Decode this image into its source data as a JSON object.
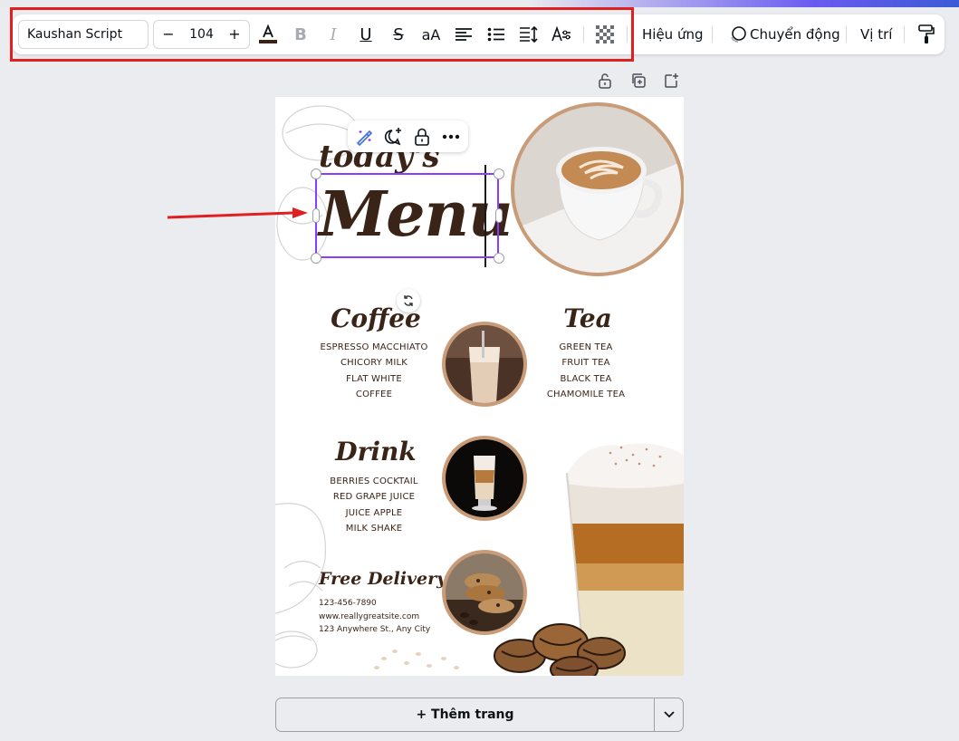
{
  "toolbar": {
    "font_family": "Kaushan Script",
    "font_size": "104",
    "minus_symbol": "−",
    "plus_symbol": "+",
    "case_label": "aA",
    "effects_label": "Hiệu ứng",
    "animate_label": "Chuyển động",
    "position_label": "Vị trí"
  },
  "floating_toolbar": {
    "icons": [
      "magic-edit-icon",
      "comment-add-icon",
      "lock-icon",
      "more-icon"
    ]
  },
  "design": {
    "heading_small": "today's",
    "heading_main": "Menu",
    "coffee": {
      "title": "Coffee",
      "items": [
        "ESPRESSO MACCHIATO",
        "CHICORY MILK",
        "FLAT WHITE",
        "COFFEE"
      ]
    },
    "tea": {
      "title": "Tea",
      "items": [
        "GREEN TEA",
        "FRUIT TEA",
        "BLACK TEA",
        "CHAMOMILE TEA"
      ]
    },
    "drink": {
      "title": "Drink",
      "items": [
        "BERRIES COCKTAIL",
        "RED GRAPE JUICE",
        "JUICE APPLE",
        "MILK SHAKE"
      ]
    },
    "delivery": {
      "title": "Free Delivery",
      "phone": "123-456-7890",
      "website": "www.reallygreatsite.com",
      "address": "123 Anywhere St., Any City"
    }
  },
  "add_page": {
    "label": "+ Thêm trang"
  },
  "colors": {
    "selection": "#8b3dff",
    "annotation": "#e02020",
    "brown_text": "#3a2418"
  }
}
